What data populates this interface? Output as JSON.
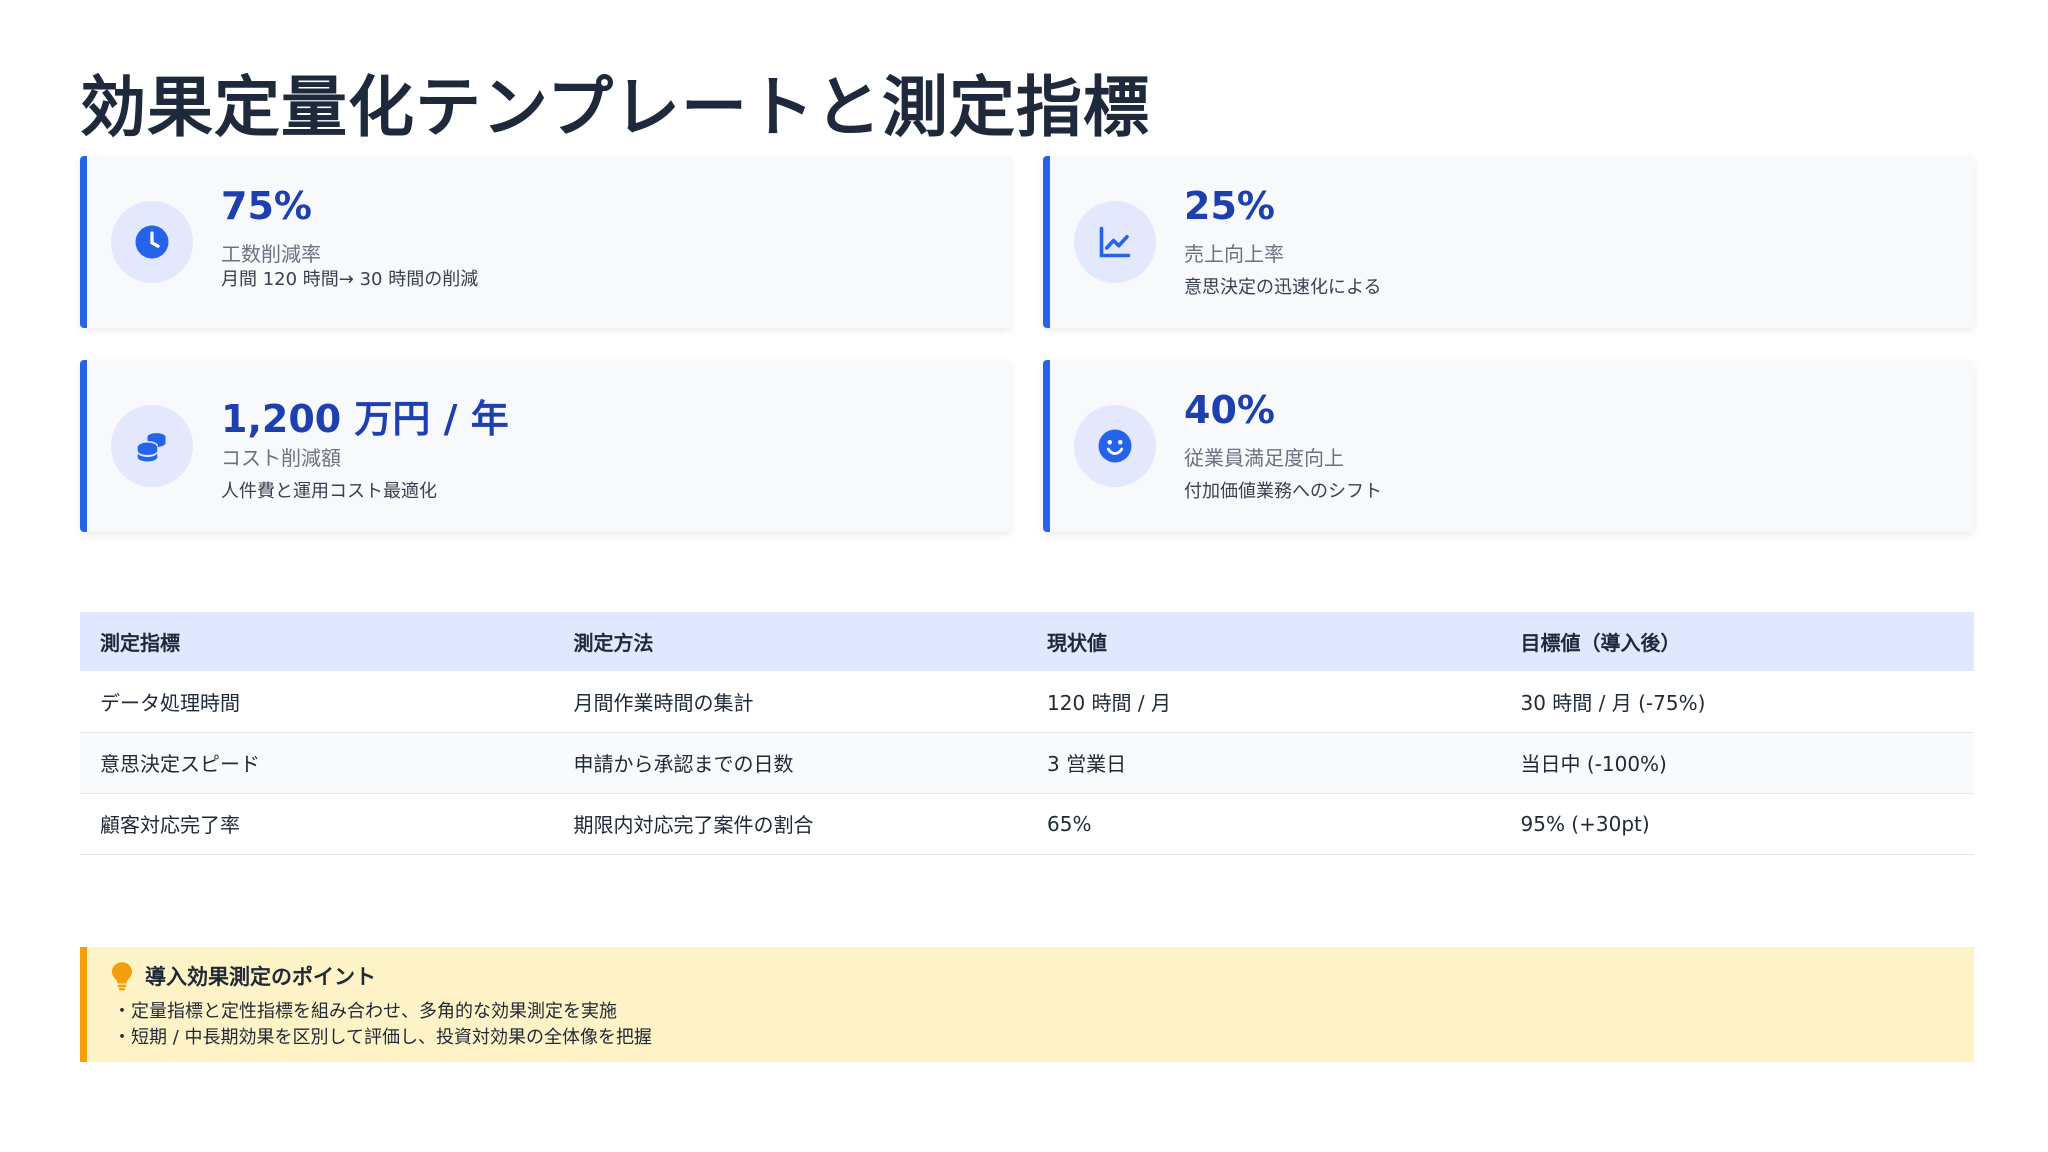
{
  "title": "効果定量化テンプレートと測定指標",
  "colors": {
    "accent": "#2563eb",
    "value_text": "#1e40af",
    "icon_bg": "#e3e8fd",
    "table_header_bg": "#e0e7ff",
    "tip_bg": "#fef3c7",
    "tip_border": "#f59e0b"
  },
  "cards": [
    {
      "icon": "clock-icon",
      "value": "75%",
      "label": "工数削減率",
      "sub": "月間 120 時間→ 30 時間の削減"
    },
    {
      "icon": "line-chart-icon",
      "value": "25%",
      "label": "売上向上率",
      "sub": "意思決定の迅速化による"
    },
    {
      "icon": "coins-icon",
      "value": "1,200 万円 / 年",
      "label": "コスト削減額",
      "sub": "人件費と運用コスト最適化"
    },
    {
      "icon": "smile-icon",
      "value": "40%",
      "label": "従業員満足度向上",
      "sub": "付加価値業務へのシフト"
    }
  ],
  "table": {
    "headers": [
      "測定指標",
      "測定方法",
      "現状値",
      "目標値（導入後）"
    ],
    "rows": [
      [
        "データ処理時間",
        "月間作業時間の集計",
        "120 時間 / 月",
        "30 時間 / 月  (-75%)"
      ],
      [
        "意思決定スピード",
        "申請から承認までの日数",
        "3 営業日",
        "当日中  (-100%)"
      ],
      [
        "顧客対応完了率",
        "期限内対応完了案件の割合",
        "65%",
        "95% (+30pt)"
      ]
    ]
  },
  "tip": {
    "icon": "lightbulb-icon",
    "title": "導入効果測定のポイント",
    "items": [
      "・定量指標と定性指標を組み合わせ、多角的な効果測定を実施",
      "・短期 / 中長期効果を区別して評価し、投資対効果の全体像を把握"
    ]
  }
}
